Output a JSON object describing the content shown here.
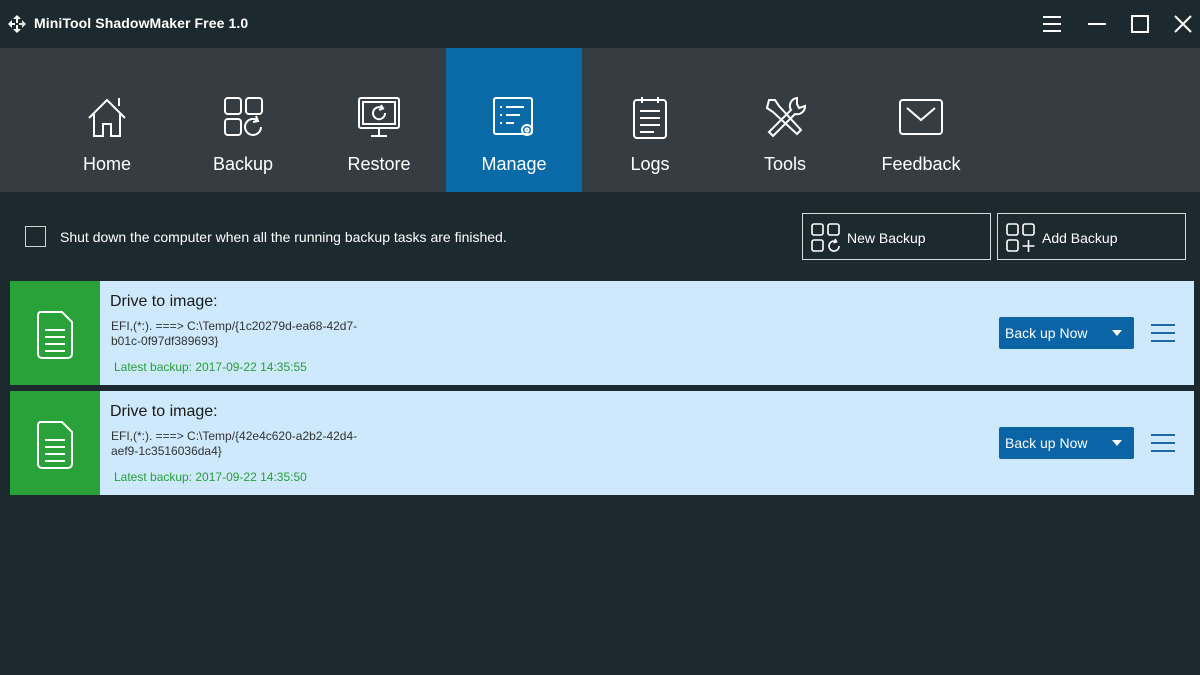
{
  "window": {
    "title": "MiniTool ShadowMaker Free 1.0",
    "icons": [
      "app-logo-icon",
      "menu-icon",
      "minimize-icon",
      "maximize-icon",
      "close-icon"
    ]
  },
  "nav": {
    "items": [
      {
        "label": "Home",
        "icon": "home-icon",
        "active": false
      },
      {
        "label": "Backup",
        "icon": "backup-icon",
        "active": false
      },
      {
        "label": "Restore",
        "icon": "restore-icon",
        "active": false
      },
      {
        "label": "Manage",
        "icon": "manage-icon",
        "active": true
      },
      {
        "label": "Logs",
        "icon": "logs-icon",
        "active": false
      },
      {
        "label": "Tools",
        "icon": "tools-icon",
        "active": false
      },
      {
        "label": "Feedback",
        "icon": "feedback-icon",
        "active": false
      }
    ],
    "active_color": "#0a6aa8"
  },
  "options": {
    "shutdown_label": "Shut down the computer when all the running backup tasks are finished.",
    "shutdown_checked": false,
    "new_backup_label": "New Backup",
    "add_backup_label": "Add Backup"
  },
  "tasks": [
    {
      "title": "Drive to image:",
      "path": "EFI,(*:). ===> C:\\Temp/{1c20279d-ea68-42d7-\nb01c-0f97df389693}",
      "latest": "Latest backup: 2017-09-22 14:35:55",
      "action_label": "Back up Now"
    },
    {
      "title": "Drive to image:",
      "path": "EFI,(*:). ===> C:\\Temp/{42e4c620-a2b2-42d4-\naef9-1c3516036da4}",
      "latest": "Latest backup: 2017-09-22 14:35:50",
      "action_label": "Back up Now"
    }
  ],
  "colors": {
    "background": "#1c2a30",
    "navbar": "#353d42",
    "card": "#cde9fb",
    "card_icon": "#2aa23a",
    "action_button": "#0b64a5",
    "latest_text": "#2a9d3d"
  }
}
